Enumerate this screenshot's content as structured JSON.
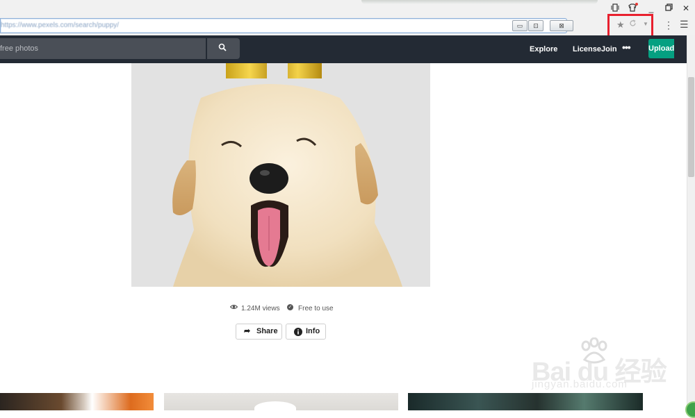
{
  "browser": {
    "url": "https://www.pexels.com/search/puppy/",
    "address_buttons": [
      "▭",
      "⊡",
      "⊠"
    ]
  },
  "header": {
    "search_placeholder": "free photos",
    "nav": {
      "explore": "Explore",
      "license": "License",
      "join": "Join",
      "more": "•••",
      "upload": "Upload"
    }
  },
  "photo": {
    "views": "1.24M views",
    "license": "Free to use"
  },
  "actions": {
    "share": "Share",
    "info": "Info"
  },
  "watermark": {
    "main": "Bai du 经验",
    "sub": "jingyan.baidu.com"
  },
  "colors": {
    "header_bg": "#232a34",
    "upload_green": "#05a081",
    "highlight_red": "#e8202e"
  }
}
